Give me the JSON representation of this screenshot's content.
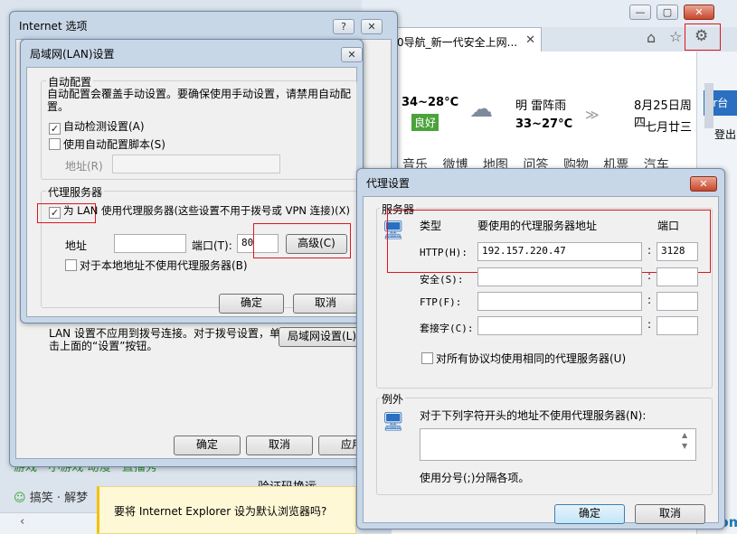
{
  "browser": {
    "tab_title": "0导航_新一代安全上网...",
    "weather": {
      "temp_today": "34~28°C",
      "air_quality": "良好",
      "forecast_label": "明 雷阵雨",
      "temp_tomorrow": "33~27°C",
      "date": "8月25日周四",
      "lunar": "七月廿三"
    },
    "nav_links": [
      "音乐",
      "微博",
      "地图",
      "问答",
      "购物",
      "机票",
      "汽车"
    ],
    "side_text_1": "or台",
    "side_text_2": "登出",
    "left_links_1": "游戏 · 小游戏   动漫 · 直播秀",
    "left_links_2": "搞笑 · 解梦",
    "bottom_text": "验证码换运",
    "default_browser_prompt": "要将 Internet Explorer 设为默认浏览器吗?",
    "watermark": "运维网 iyunv.com"
  },
  "internet_options": {
    "title": "Internet 选项",
    "lan_note": "LAN 设置不应用到拨号连接。对于拨号设置，单击上面的“设置”按钮。",
    "lan_settings_button": "局域网设置(L)",
    "ok": "确定",
    "cancel": "取消",
    "apply": "应用"
  },
  "lan_dialog": {
    "title": "局域网(LAN)设置",
    "auto_config_header": "自动配置",
    "auto_config_desc": "自动配置会覆盖手动设置。要确保使用手动设置，请禁用自动配置。",
    "auto_detect": "自动检测设置(A)",
    "auto_detect_checked": true,
    "use_script": "使用自动配置脚本(S)",
    "use_script_checked": false,
    "address_label": "地址(R)",
    "proxy_header": "代理服务器",
    "use_proxy": "为 LAN 使用代理服务器(这些设置不用于拨号或 VPN 连接)(X)",
    "use_proxy_checked": true,
    "proxy_address_label": "地址",
    "proxy_address_value": "",
    "port_label": "端口(T):",
    "port_value": "80",
    "advanced_button": "高级(C)",
    "bypass_local": "对于本地地址不使用代理服务器(B)",
    "bypass_local_checked": false,
    "ok": "确定",
    "cancel": "取消"
  },
  "proxy_dialog": {
    "title": "代理设置",
    "servers_header": "服务器",
    "col_type": "类型",
    "col_address": "要使用的代理服务器地址",
    "col_port": "端口",
    "rows": [
      {
        "label": "HTTP(H):",
        "address": "192.157.220.47",
        "port": "3128"
      },
      {
        "label": "安全(S):",
        "address": "",
        "port": ""
      },
      {
        "label": "FTP(F):",
        "address": "",
        "port": ""
      },
      {
        "label": "套接字(C):",
        "address": "",
        "port": ""
      }
    ],
    "same_for_all": "对所有协议均使用相同的代理服务器(U)",
    "same_for_all_checked": false,
    "exceptions_header": "例外",
    "exceptions_desc": "对于下列字符开头的地址不使用代理服务器(N):",
    "exceptions_value": "",
    "separator_note": "使用分号(;)分隔各项。",
    "ok": "确定",
    "cancel": "取消"
  }
}
